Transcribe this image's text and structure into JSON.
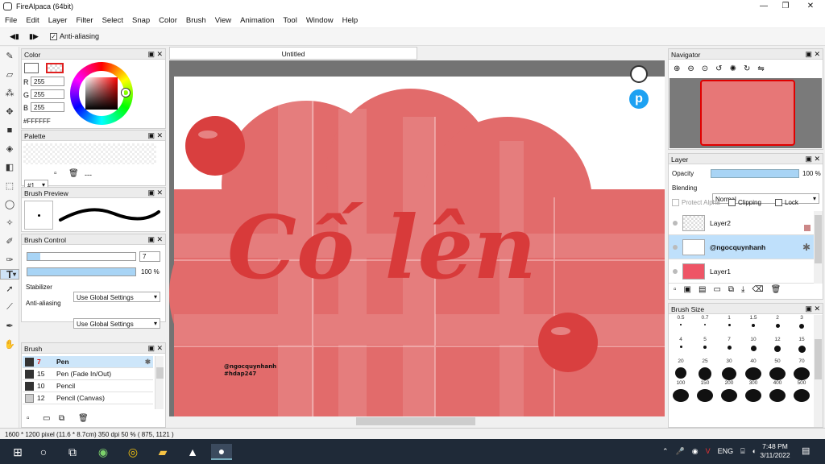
{
  "window": {
    "title": "FireAlpaca (64bit)"
  },
  "menu": [
    "File",
    "Edit",
    "Layer",
    "Filter",
    "Select",
    "Snap",
    "Color",
    "Brush",
    "View",
    "Animation",
    "Tool",
    "Window",
    "Help"
  ],
  "tool_options": {
    "antialias_label": "Anti-aliasing"
  },
  "color_panel": {
    "title": "Color",
    "r": "255",
    "g": "255",
    "b": "255",
    "hex": "#FFFFFF",
    "r_label": "R",
    "g_label": "G",
    "b_label": "B"
  },
  "palette_panel": {
    "title": "Palette",
    "set": "#1",
    "dash": "---"
  },
  "brush_preview_panel": {
    "title": "Brush Preview"
  },
  "brush_control_panel": {
    "title": "Brush Control",
    "size": "7",
    "opacity": "100 %",
    "stabilizer_label": "Stabilizer",
    "stabilizer_value": "Use Global Settings",
    "aa_label": "Anti-aliasing",
    "aa_value": "Use Global Settings"
  },
  "brush_panel": {
    "title": "Brush",
    "items": [
      {
        "num": "7",
        "name": "Pen",
        "selected": true
      },
      {
        "num": "15",
        "name": "Pen (Fade In/Out)"
      },
      {
        "num": "10",
        "name": "Pencil"
      },
      {
        "num": "12",
        "name": "Pencil (Canvas)"
      }
    ]
  },
  "canvas": {
    "tab": "Untitled",
    "art_text": "Cố lên",
    "watermark_1": "@ngocquynhanh",
    "watermark_2": "#hdap247"
  },
  "navigator_panel": {
    "title": "Navigator"
  },
  "layer_panel": {
    "title": "Layer",
    "opacity_label": "Opacity",
    "opacity": "100 %",
    "blending_label": "Blending",
    "blending": "Normal",
    "protect_alpha": "Protect Alpha",
    "clipping": "Clipping",
    "lock": "Lock",
    "layers": [
      {
        "name": "Layer2"
      },
      {
        "name": "@ngocquynhanh",
        "selected": true
      },
      {
        "name": "Layer1"
      }
    ]
  },
  "brush_size_panel": {
    "title": "Brush Size",
    "sizes": [
      "0.5",
      "0.7",
      "1",
      "1.5",
      "2",
      "3",
      "4",
      "5",
      "7",
      "10",
      "12",
      "15",
      "20",
      "25",
      "30",
      "40",
      "50",
      "70",
      "100",
      "150",
      "200",
      "300",
      "400",
      "500"
    ]
  },
  "status": {
    "text": "1600 * 1200 pixel   (11.6 * 8.7cm)   350 dpi   50 %   ( 875, 1121 )"
  },
  "taskbar": {
    "lang": "ENG",
    "time": "7:48 PM",
    "date": "3/11/2022"
  }
}
